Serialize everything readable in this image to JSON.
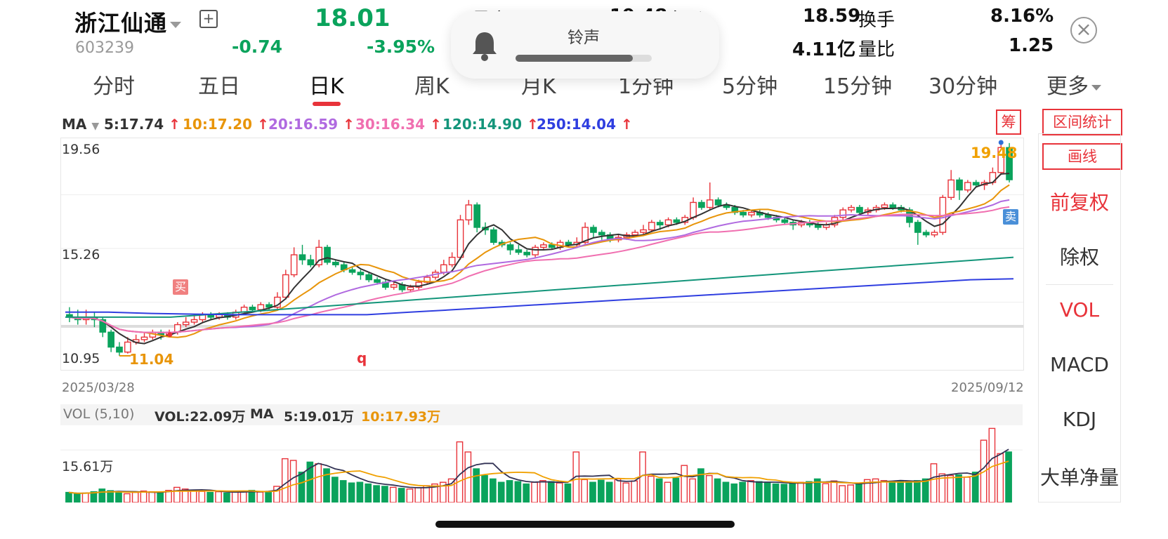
{
  "stock": {
    "name": "浙江仙通",
    "code": "603239",
    "price": "18.01",
    "change": "-0.74",
    "change_pct": "-3.95%",
    "add_icon": "plus-square-icon",
    "stats": {
      "high_label": "最高",
      "high_value": "19.48",
      "open_label": "今开",
      "open_value": "18.59",
      "turnover_label": "换手",
      "turnover_value": "8.16%",
      "amount_value": "4.11亿",
      "vol_ratio_label": "量比",
      "vol_ratio_value": "1.25"
    }
  },
  "toast": {
    "label": "铃声",
    "icon": "bell-icon",
    "level": 0.86
  },
  "tabs": [
    "分时",
    "五日",
    "日K",
    "周K",
    "月K",
    "1分钟",
    "5分钟",
    "15分钟",
    "30分钟",
    "更多"
  ],
  "active_tab": "日K",
  "ma": {
    "label": "MA",
    "items": [
      {
        "text": "5:17.74",
        "color": "#333333"
      },
      {
        "text": "10:17.20",
        "color": "#e8950a"
      },
      {
        "text": "20:16.59",
        "color": "#b06ae0"
      },
      {
        "text": "30:16.34",
        "color": "#f06fb0"
      },
      {
        "text": "120:14.90",
        "color": "#13957a"
      },
      {
        "text": "250:14.04",
        "color": "#2f3ee0"
      }
    ]
  },
  "chip_button": "筹",
  "chart": {
    "y_top": "19.56",
    "y_mid": "15.26",
    "y_bottom": "10.95",
    "low_mark": "11.04",
    "high_mark": "19.48",
    "q_label": "q",
    "buy_marker": "买",
    "sell_marker": "卖",
    "date_start": "2025/03/28",
    "date_end": "2025/09/12"
  },
  "vol": {
    "header_label": "VOL (5,10)",
    "vol_value": "VOL:22.09万",
    "ma_label": "MA",
    "ma5": "5:19.01万",
    "ma10": "10:17.93万",
    "y_label": "15.61万"
  },
  "sidebar": {
    "range_stats": "区间统计",
    "draw_line": "画线",
    "items": [
      "前复权",
      "除权",
      "VOL",
      "MACD",
      "KDJ",
      "大单净量"
    ]
  },
  "close_icon": "close-circle-icon",
  "colors": {
    "up": "#e8333a",
    "down": "#0aa35c",
    "accent": "#e8333a"
  },
  "chart_data": {
    "type": "candlestick",
    "x_range": [
      "2025/03/28",
      "2025/09/12"
    ],
    "ylim": [
      10.95,
      19.56
    ],
    "candles": [
      [
        12.6,
        12.5,
        12.9,
        12.3
      ],
      [
        12.5,
        12.4,
        12.8,
        12.2
      ],
      [
        12.4,
        12.5,
        12.8,
        12.2
      ],
      [
        12.5,
        12.4,
        12.7,
        12.1
      ],
      [
        12.4,
        11.9,
        12.5,
        11.7
      ],
      [
        11.9,
        11.3,
        12.0,
        11.1
      ],
      [
        11.3,
        11.1,
        11.5,
        10.95
      ],
      [
        11.1,
        11.5,
        11.7,
        11.04
      ],
      [
        11.5,
        11.6,
        11.8,
        11.4
      ],
      [
        11.6,
        11.7,
        11.9,
        11.5
      ],
      [
        11.7,
        11.9,
        12.0,
        11.6
      ],
      [
        11.9,
        11.8,
        12.0,
        11.6
      ],
      [
        11.8,
        11.9,
        12.0,
        11.7
      ],
      [
        11.9,
        12.2,
        12.3,
        11.8
      ],
      [
        12.2,
        12.3,
        12.5,
        12.1
      ],
      [
        12.3,
        12.4,
        12.6,
        12.2
      ],
      [
        12.4,
        12.6,
        12.7,
        12.3
      ],
      [
        12.6,
        12.5,
        12.7,
        12.4
      ],
      [
        12.5,
        12.6,
        12.7,
        12.4
      ],
      [
        12.6,
        12.5,
        12.7,
        12.4
      ],
      [
        12.5,
        12.7,
        12.8,
        12.4
      ],
      [
        12.7,
        12.9,
        13.0,
        12.6
      ],
      [
        12.9,
        12.8,
        13.0,
        12.7
      ],
      [
        12.8,
        13.0,
        13.1,
        12.7
      ],
      [
        13.0,
        12.9,
        13.1,
        12.8
      ],
      [
        12.9,
        13.3,
        13.5,
        12.8
      ],
      [
        13.3,
        14.2,
        14.4,
        13.2
      ],
      [
        14.2,
        15.0,
        15.3,
        14.1
      ],
      [
        15.0,
        14.8,
        15.4,
        14.6
      ],
      [
        14.8,
        14.6,
        15.0,
        14.5
      ],
      [
        14.6,
        15.3,
        15.6,
        14.5
      ],
      [
        15.3,
        14.7,
        15.4,
        14.6
      ],
      [
        14.7,
        14.6,
        14.8,
        14.5
      ],
      [
        14.6,
        14.4,
        14.7,
        14.3
      ],
      [
        14.4,
        14.3,
        14.5,
        14.2
      ],
      [
        14.3,
        14.2,
        14.4,
        14.0
      ],
      [
        14.2,
        14.0,
        14.3,
        13.9
      ],
      [
        14.0,
        13.9,
        14.1,
        13.8
      ],
      [
        13.9,
        13.7,
        14.0,
        13.6
      ],
      [
        13.7,
        13.8,
        13.9,
        13.6
      ],
      [
        13.8,
        13.6,
        13.9,
        13.5
      ],
      [
        13.6,
        13.7,
        13.8,
        13.5
      ],
      [
        13.7,
        13.9,
        14.0,
        13.6
      ],
      [
        13.9,
        14.1,
        14.2,
        13.8
      ],
      [
        14.1,
        14.3,
        14.4,
        14.0
      ],
      [
        14.3,
        14.6,
        14.8,
        14.2
      ],
      [
        14.6,
        14.9,
        15.1,
        14.5
      ],
      [
        14.9,
        16.4,
        16.6,
        14.8
      ],
      [
        16.4,
        17.0,
        17.2,
        16.2
      ],
      [
        17.0,
        16.1,
        17.1,
        15.9
      ],
      [
        16.1,
        16.0,
        16.3,
        15.8
      ],
      [
        16.0,
        15.5,
        16.1,
        15.4
      ],
      [
        15.5,
        15.4,
        15.6,
        15.3
      ],
      [
        15.4,
        15.2,
        15.5,
        15.0
      ],
      [
        15.2,
        15.1,
        15.4,
        15.0
      ],
      [
        15.1,
        15.0,
        15.2,
        14.9
      ],
      [
        15.0,
        15.3,
        15.4,
        14.9
      ],
      [
        15.3,
        15.4,
        15.5,
        15.2
      ],
      [
        15.4,
        15.3,
        15.5,
        15.2
      ],
      [
        15.3,
        15.5,
        15.6,
        15.2
      ],
      [
        15.5,
        15.4,
        15.6,
        15.3
      ],
      [
        15.4,
        15.5,
        15.7,
        15.3
      ],
      [
        15.5,
        16.1,
        16.3,
        15.4
      ],
      [
        16.1,
        15.9,
        16.2,
        15.7
      ],
      [
        15.9,
        15.8,
        16.0,
        15.6
      ],
      [
        15.8,
        15.6,
        15.9,
        15.5
      ],
      [
        15.6,
        15.7,
        15.8,
        15.5
      ],
      [
        15.7,
        15.8,
        15.9,
        15.6
      ],
      [
        15.8,
        15.9,
        16.0,
        15.7
      ],
      [
        15.9,
        16.0,
        16.2,
        15.8
      ],
      [
        16.0,
        16.3,
        16.4,
        15.9
      ],
      [
        16.3,
        16.2,
        16.4,
        16.0
      ],
      [
        16.2,
        16.4,
        16.5,
        16.1
      ],
      [
        16.4,
        16.3,
        16.5,
        16.2
      ],
      [
        16.3,
        16.5,
        16.6,
        16.2
      ],
      [
        16.5,
        17.1,
        17.3,
        16.4
      ],
      [
        17.1,
        16.9,
        17.2,
        16.8
      ],
      [
        16.9,
        17.2,
        17.9,
        16.8
      ],
      [
        17.2,
        17.0,
        17.3,
        16.9
      ],
      [
        17.0,
        16.9,
        17.1,
        16.8
      ],
      [
        16.9,
        16.7,
        17.0,
        16.6
      ],
      [
        16.7,
        16.6,
        16.8,
        16.5
      ],
      [
        16.6,
        16.7,
        16.8,
        16.5
      ],
      [
        16.7,
        16.6,
        16.8,
        16.5
      ],
      [
        16.6,
        16.5,
        16.7,
        16.4
      ],
      [
        16.5,
        16.4,
        16.6,
        16.3
      ],
      [
        16.4,
        16.3,
        16.5,
        16.2
      ],
      [
        16.3,
        16.2,
        16.4,
        16.0
      ],
      [
        16.2,
        16.3,
        16.4,
        16.1
      ],
      [
        16.3,
        16.2,
        16.4,
        16.1
      ],
      [
        16.2,
        16.1,
        16.3,
        16.0
      ],
      [
        16.1,
        16.2,
        16.3,
        16.0
      ],
      [
        16.2,
        16.5,
        16.6,
        16.1
      ],
      [
        16.5,
        16.8,
        16.9,
        16.4
      ],
      [
        16.8,
        16.9,
        17.0,
        16.7
      ],
      [
        16.9,
        16.7,
        17.0,
        16.6
      ],
      [
        16.7,
        16.8,
        16.9,
        16.6
      ],
      [
        16.8,
        16.9,
        17.0,
        16.7
      ],
      [
        16.9,
        17.0,
        17.1,
        16.8
      ],
      [
        17.0,
        16.9,
        17.1,
        16.8
      ],
      [
        16.9,
        16.8,
        17.0,
        16.7
      ],
      [
        16.8,
        16.3,
        16.9,
        16.1
      ],
      [
        16.3,
        15.9,
        16.4,
        15.4
      ],
      [
        15.9,
        15.8,
        16.0,
        15.7
      ],
      [
        15.8,
        15.9,
        16.0,
        15.7
      ],
      [
        15.9,
        17.3,
        17.4,
        15.8
      ],
      [
        17.3,
        18.0,
        18.4,
        17.2
      ],
      [
        18.0,
        17.6,
        18.1,
        17.2
      ],
      [
        17.6,
        17.9,
        18.0,
        17.5
      ],
      [
        17.9,
        17.8,
        18.0,
        17.7
      ],
      [
        17.8,
        17.9,
        18.0,
        17.6
      ],
      [
        17.9,
        18.3,
        18.5,
        17.8
      ],
      [
        18.3,
        19.3,
        19.56,
        18.2
      ],
      [
        19.3,
        18.01,
        19.48,
        17.9
      ]
    ],
    "series": [
      {
        "name": "MA5",
        "color": "#333333"
      },
      {
        "name": "MA10",
        "color": "#e8950a"
      },
      {
        "name": "MA20",
        "color": "#b06ae0"
      },
      {
        "name": "MA30",
        "color": "#f06fb0"
      },
      {
        "name": "MA120",
        "color": "#13957a",
        "values": [
          12.5,
          12.5,
          12.5,
          12.5,
          12.6,
          12.7,
          12.8,
          12.9,
          13.0,
          13.1,
          13.2,
          13.3,
          13.4,
          13.5,
          13.6,
          13.7,
          13.8,
          13.9,
          14.0,
          14.1,
          14.2,
          14.3,
          14.4,
          14.5,
          14.6,
          14.7,
          14.8,
          14.9
        ]
      },
      {
        "name": "MA250",
        "color": "#2f3ee0",
        "values": [
          12.7,
          12.7,
          12.65,
          12.62,
          12.6,
          12.6,
          12.6,
          12.6,
          12.7,
          12.8,
          12.9,
          13.0,
          13.1,
          13.2,
          13.3,
          13.4,
          13.5,
          13.6,
          13.7,
          13.8,
          13.9,
          14.0,
          14.04
        ]
      }
    ],
    "volume": {
      "y_label": "15.61万",
      "ymax": 22.5,
      "values": [
        3,
        2.5,
        2.8,
        3.2,
        4,
        3.5,
        3,
        2.6,
        3,
        3.4,
        3.2,
        2.9,
        3.6,
        4.5,
        4,
        3.5,
        3.3,
        3,
        3.2,
        2.8,
        3.1,
        3.4,
        3.6,
        3.1,
        3.3,
        4.8,
        13,
        12.5,
        9,
        12,
        11.5,
        10,
        7.5,
        6.5,
        5.8,
        6,
        5.5,
        5,
        4.8,
        4.5,
        4.2,
        4,
        4.4,
        5,
        5.5,
        6,
        7,
        18,
        15,
        10,
        8,
        7,
        6,
        6.5,
        6.2,
        5.5,
        6,
        6.5,
        6.2,
        5.8,
        5.5,
        15,
        6.8,
        6,
        6.6,
        6,
        7,
        5.8,
        6.4,
        15,
        7.8,
        7,
        6,
        7.2,
        11,
        7,
        10,
        8,
        7,
        6,
        5.5,
        6,
        6.5,
        6.2,
        6,
        5.5,
        5.4,
        5.8,
        6,
        6.2,
        7,
        5.6,
        6.4,
        5,
        5.2,
        5.5,
        6.8,
        7,
        6.5,
        6,
        6.4,
        6.2,
        6.5,
        7,
        11.5,
        8.5,
        8,
        8.2,
        7.5,
        9,
        18.5,
        22,
        14.5,
        15,
        10,
        19,
        22,
        15
      ]
    }
  }
}
